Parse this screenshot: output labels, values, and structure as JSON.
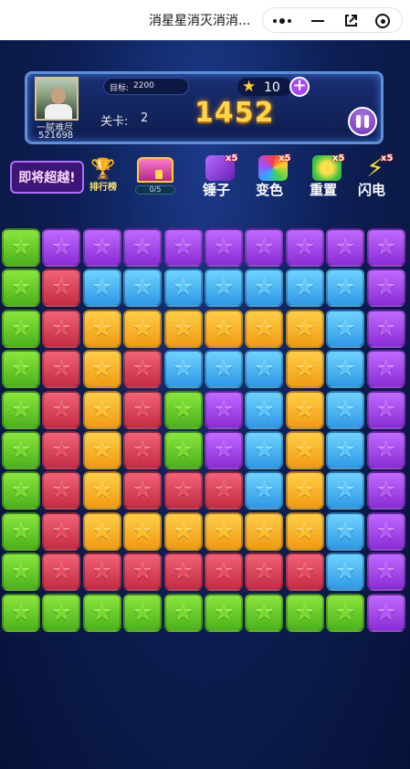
{
  "topbar": {
    "title": "消星星消灭消消...",
    "icons": [
      "more-icon",
      "minimize-icon",
      "share-icon",
      "close-icon"
    ]
  },
  "player": {
    "nickname": "一腻难尽",
    "id": "521698"
  },
  "goal": {
    "label": "目标:",
    "value": "2200"
  },
  "level": {
    "label": "关卡:",
    "value": "2"
  },
  "score": "1452",
  "coins": "10",
  "surpass_label": "即将超越!",
  "rank_label": "排行榜",
  "chest_progress": "0/5",
  "tools": [
    {
      "label": "锤子",
      "count": "x5",
      "icon": "hammer-icon"
    },
    {
      "label": "变色",
      "count": "x5",
      "icon": "paint-brush-icon"
    },
    {
      "label": "重置",
      "count": "x5",
      "icon": "reset-icon"
    },
    {
      "label": "闪电",
      "count": "x5",
      "icon": "lightning-icon"
    }
  ],
  "board": {
    "star_glyph": "★",
    "colors": {
      "g": "#5cc426",
      "p": "#a745ef",
      "r": "#dc3f56",
      "b": "#46b6f6",
      "y": "#fbb32a"
    },
    "grid": [
      [
        "g",
        "p",
        "p",
        "p",
        "p",
        "p",
        "p",
        "p",
        "p",
        "p"
      ],
      [
        "g",
        "r",
        "b",
        "b",
        "b",
        "b",
        "b",
        "b",
        "b",
        "p"
      ],
      [
        "g",
        "r",
        "y",
        "y",
        "y",
        "y",
        "y",
        "y",
        "b",
        "p"
      ],
      [
        "g",
        "r",
        "y",
        "r",
        "b",
        "b",
        "b",
        "y",
        "b",
        "p"
      ],
      [
        "g",
        "r",
        "y",
        "r",
        "g",
        "p",
        "b",
        "y",
        "b",
        "p"
      ],
      [
        "g",
        "r",
        "y",
        "r",
        "g",
        "p",
        "b",
        "y",
        "b",
        "p"
      ],
      [
        "g",
        "r",
        "y",
        "r",
        "r",
        "r",
        "b",
        "y",
        "b",
        "p"
      ],
      [
        "g",
        "r",
        "y",
        "y",
        "y",
        "y",
        "y",
        "y",
        "b",
        "p"
      ],
      [
        "g",
        "r",
        "r",
        "r",
        "r",
        "r",
        "r",
        "r",
        "b",
        "p"
      ],
      [
        "g",
        "g",
        "g",
        "g",
        "g",
        "g",
        "g",
        "g",
        "g",
        "p"
      ]
    ]
  }
}
